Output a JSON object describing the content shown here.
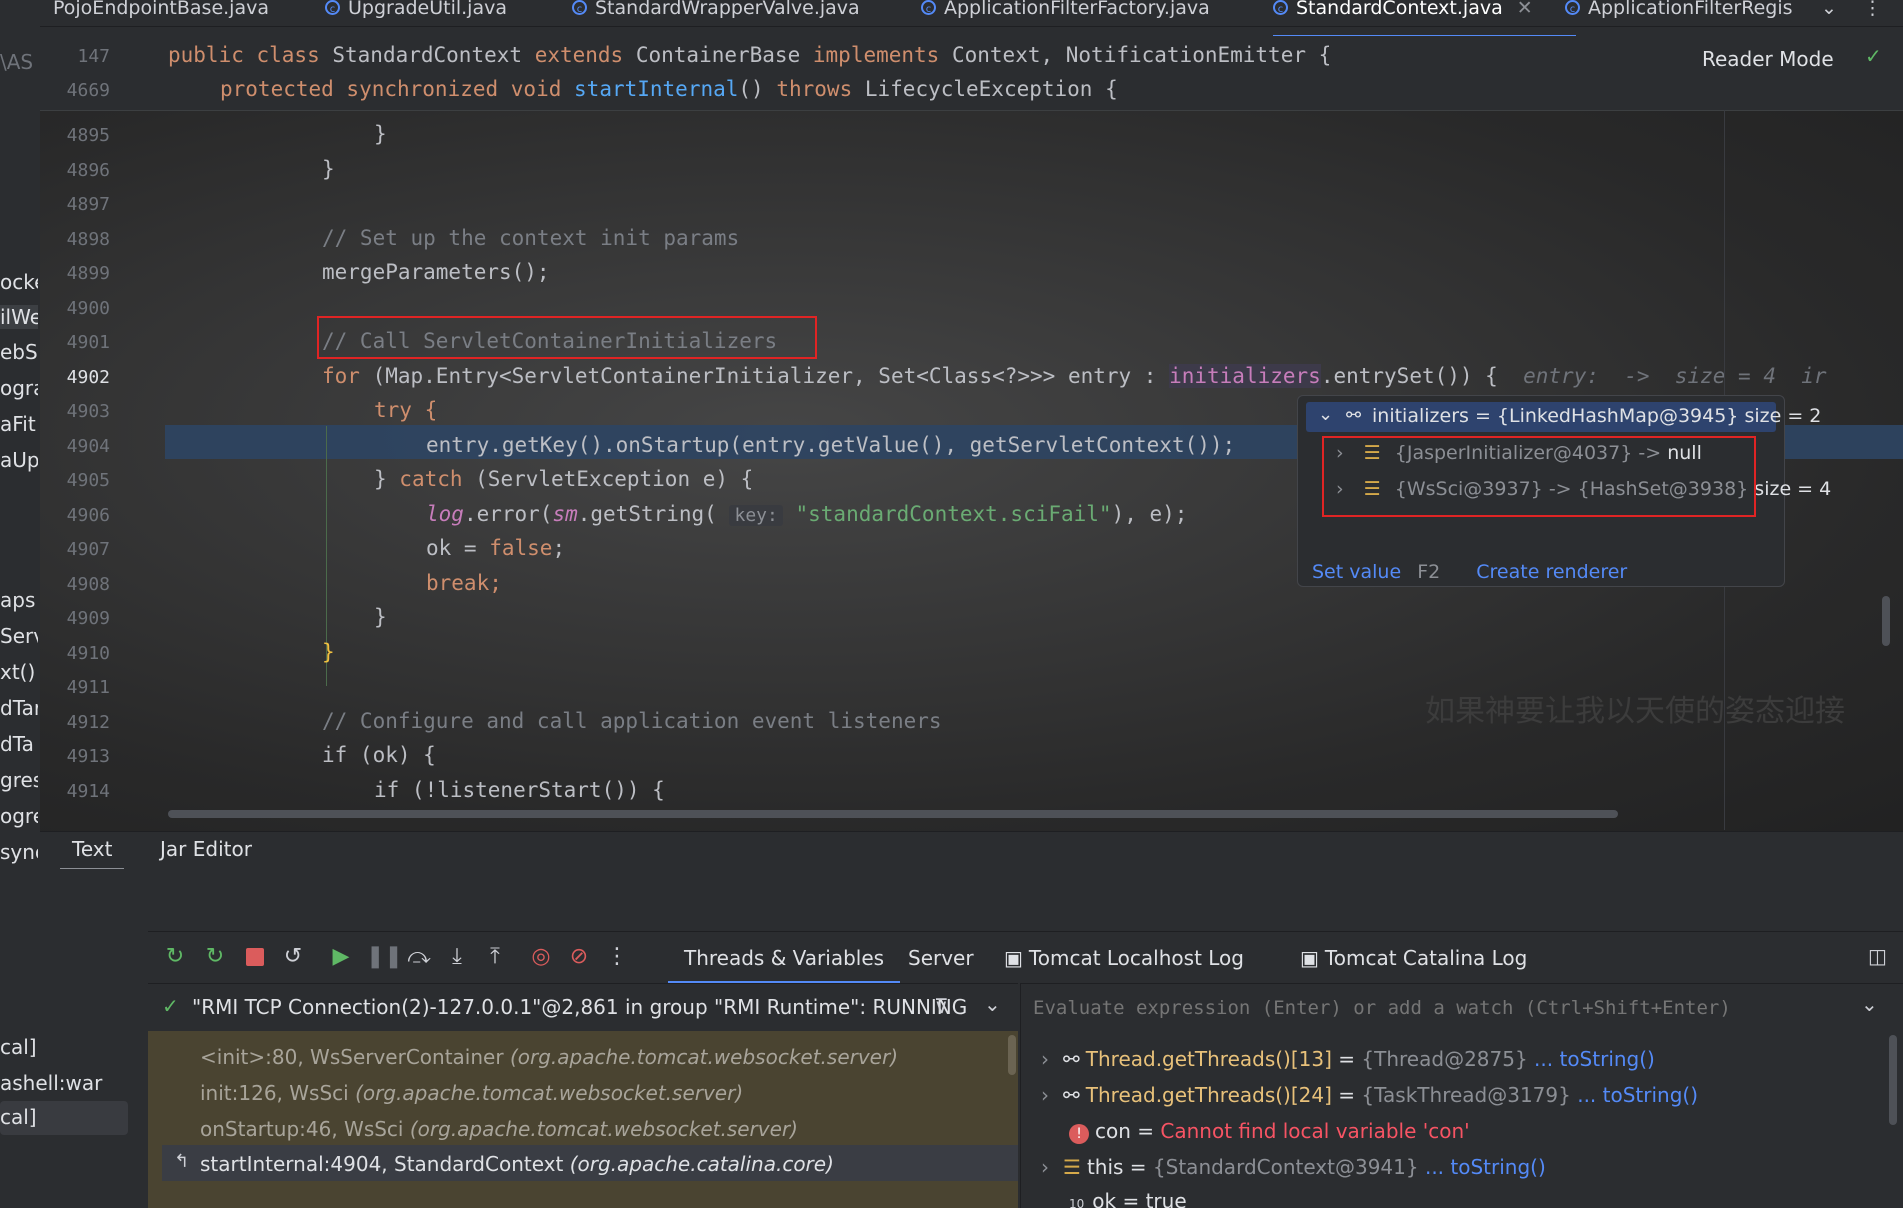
{
  "tabs": [
    {
      "label": "PojoEndpointBase.java",
      "icon": "class-icon"
    },
    {
      "label": "UpgradeUtil.java",
      "icon": "class-icon"
    },
    {
      "label": "StandardWrapperValve.java",
      "icon": "class-icon"
    },
    {
      "label": "ApplicationFilterFactory.java",
      "icon": "class-icon"
    },
    {
      "label": "StandardContext.java",
      "icon": "class-icon",
      "active": true
    },
    {
      "label": "ApplicationFilterRegis",
      "icon": "class-icon"
    }
  ],
  "reader_mode": "Reader Mode",
  "left_panel": {
    "items": [
      "\\AS",
      "ocke",
      "ilWe",
      "ebSc",
      "ogra",
      "aFit",
      "aUp",
      "aps",
      "Servl",
      "xt()",
      "dTar",
      "dTa",
      "gres",
      "ogre",
      "sync",
      "cal]",
      "ashell:war",
      "cal]"
    ]
  },
  "sticky": {
    "line1_num": "147",
    "line1": {
      "kw1": "public class",
      "name": "StandardContext",
      "kw2": "extends",
      "base": "ContainerBase",
      "kw3": "implements",
      "rest": "Context, NotificationEmitter {"
    },
    "line2_num": "4669",
    "line2": {
      "kw1": "protected synchronized void",
      "name": "startInternal",
      "rest1": "()",
      "kw2": "throws",
      "rest2": "LifecycleException {"
    }
  },
  "code": {
    "lines": [
      {
        "num": "4895",
        "text": "}"
      },
      {
        "num": "4896",
        "text": "}"
      },
      {
        "num": "4897",
        "text": ""
      },
      {
        "num": "4898",
        "text": "// Set up the context init params"
      },
      {
        "num": "4899",
        "text": "mergeParameters();"
      },
      {
        "num": "4900",
        "text": ""
      },
      {
        "num": "4901",
        "text": "// Call ServletContainerInitializers"
      },
      {
        "num": "4902",
        "text": ""
      },
      {
        "num": "4903",
        "text": "try {"
      },
      {
        "num": "4904",
        "text": "entry.getKey().onStartup(entry.getValue(), getServletContext());"
      },
      {
        "num": "4905",
        "text": ""
      },
      {
        "num": "4906",
        "text": ""
      },
      {
        "num": "4907",
        "text": ""
      },
      {
        "num": "4908",
        "text": "break;"
      },
      {
        "num": "4909",
        "text": "}"
      },
      {
        "num": "4910",
        "text": "}"
      },
      {
        "num": "4911",
        "text": ""
      },
      {
        "num": "4912",
        "text": "// Configure and call application event listeners"
      },
      {
        "num": "4913",
        "text": "if (ok) {"
      },
      {
        "num": "4914",
        "text": "if (!listenerStart()) {"
      }
    ],
    "line4902": {
      "kw": "for",
      "p1": " (Map.Entry<ServletContainerInitializer, Set<Class<?>>> entry : ",
      "field": "initializers",
      "p2": ".entrySet()) {",
      "hint": "entry:  ->  size = 4  ir"
    },
    "line4905": {
      "p1": "} ",
      "kw": "catch",
      "p2": " (ServletException e) {"
    },
    "line4906": {
      "log": "log",
      "p1": ".error(",
      "sm": "sm",
      "p2": ".getString(",
      "key": "key:",
      "str": "\"standardContext.sciFail\"",
      "p3": "), e);"
    },
    "line4907": {
      "p1": "ok = ",
      "kw": "false",
      "p2": ";"
    }
  },
  "popup": {
    "root": {
      "label": "initializers = {LinkedHashMap@3945}",
      "size": "size = 2"
    },
    "children": [
      {
        "key": "{JasperInitializer@4037}",
        "arrow": "->",
        "value": "null",
        "size": ""
      },
      {
        "key": "{WsSci@3937}",
        "arrow": "->",
        "value": "{HashSet@3938}",
        "size": "size = 4"
      }
    ],
    "set_value": "Set value",
    "set_value_key": "F2",
    "create_renderer": "Create renderer"
  },
  "watermark": "如果神要让我以天使的姿态迎接",
  "bottom_tabs": [
    "Text",
    "Jar Editor"
  ],
  "debug_tabs": [
    {
      "label": "Threads & Variables",
      "active": true
    },
    {
      "label": "Server"
    },
    {
      "label": "Tomcat Localhost Log"
    },
    {
      "label": "Tomcat Catalina Log"
    }
  ],
  "thread": "\"RMI TCP Connection(2)-127.0.0.1\"@2,861 in group \"RMI Runtime\": RUNNING",
  "eval_placeholder": "Evaluate expression (Enter) or add a watch (Ctrl+Shift+Enter)",
  "frames": [
    {
      "method": "<init>:80, WsServerContainer",
      "pkg": "(org.apache.tomcat.websocket.server)"
    },
    {
      "method": "init:126, WsSci",
      "pkg": "(org.apache.tomcat.websocket.server)"
    },
    {
      "method": "onStartup:46, WsSci",
      "pkg": "(org.apache.tomcat.websocket.server)"
    },
    {
      "method": "startInternal:4904, StandardContext",
      "pkg": "(org.apache.catalina.core)"
    }
  ],
  "variables": [
    {
      "name": "Thread.getThreads()[13]",
      "eq": "=",
      "value": "{Thread@2875}",
      "link": "... toString()",
      "icon": "watch-icon"
    },
    {
      "name": "Thread.getThreads()[24]",
      "eq": "=",
      "value": "{TaskThread@3179}",
      "link": "... toString()",
      "icon": "watch-icon"
    },
    {
      "name": "con",
      "eq": "=",
      "value": "Cannot find local variable 'con'",
      "link": "",
      "icon": "error-icon"
    },
    {
      "name": "this",
      "eq": "=",
      "value": "{StandardContext@3941}",
      "link": "... toString()",
      "icon": "field-icon"
    },
    {
      "name": "ok",
      "eq": "=",
      "value": "true",
      "link": "",
      "icon": "boolean-icon"
    }
  ]
}
